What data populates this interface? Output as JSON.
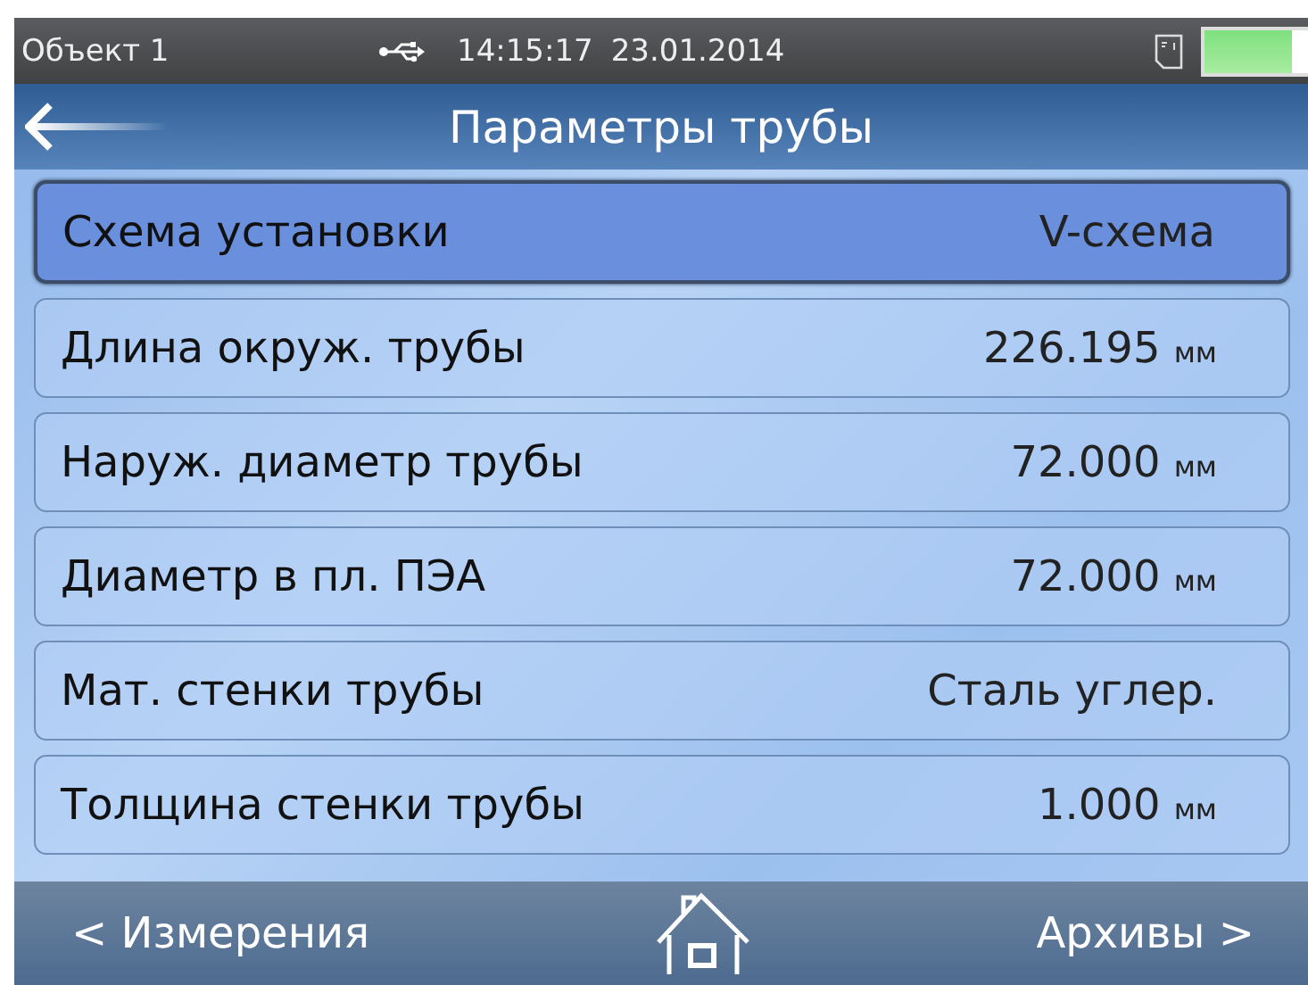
{
  "status_bar": {
    "object": "Объект 1",
    "time": "14:15:17",
    "date": "23.01.2014"
  },
  "title": "Параметры трубы",
  "rows": [
    {
      "label": "Схема установки",
      "value": "V-схема",
      "selected": true
    },
    {
      "label": "Длина окруж. трубы",
      "value": "226.195",
      "unit": "мм",
      "selected": false
    },
    {
      "label": "Наруж. диаметр трубы",
      "value": "72.000",
      "unit": "мм",
      "selected": false
    },
    {
      "label": "Диаметр в пл. ПЭА",
      "value": "72.000",
      "unit": "мм",
      "selected": false
    },
    {
      "label": "Мат. стенки трубы",
      "value": "Сталь углер.",
      "selected": false
    },
    {
      "label": "Толщина стенки трубы",
      "value": "1.000",
      "unit": "мм",
      "selected": false
    }
  ],
  "bottom_bar": {
    "left": "< Измерения",
    "right": "Архивы >"
  }
}
